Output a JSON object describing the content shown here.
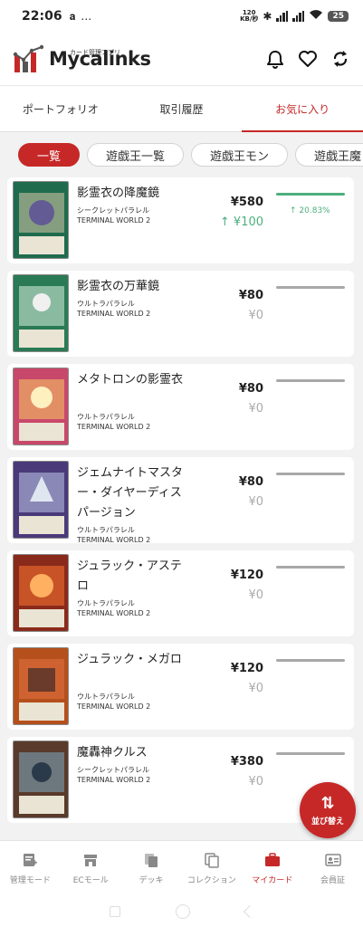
{
  "status_bar": {
    "time": "22:06",
    "left_icons": "…",
    "net_speed_top": "120",
    "net_speed_bottom": "KB/秒",
    "battery": "25"
  },
  "header": {
    "logo_sub": "カード管理アプリ",
    "logo_main": "Mycalinks",
    "icons": [
      "bell-icon",
      "heart-icon",
      "sync-icon"
    ]
  },
  "tabs": [
    {
      "label": "ポートフォリオ",
      "active": false
    },
    {
      "label": "取引履歴",
      "active": false
    },
    {
      "label": "お気に入り",
      "active": true
    }
  ],
  "chips": [
    {
      "label": "一覧",
      "active": true
    },
    {
      "label": "遊戯王一覧",
      "active": false
    },
    {
      "label": "遊戯王モン",
      "active": false
    },
    {
      "label": "遊戯王魔",
      "active": false
    }
  ],
  "cards": [
    {
      "name": "影霊衣の降魔鏡",
      "rarity": "シークレットパラレル",
      "set": "TERMINAL WORLD 2",
      "price": "¥580",
      "diff": "↑ ¥100",
      "diff_up": true,
      "pct": "↑ 20.83%"
    },
    {
      "name": "影霊衣の万華鏡",
      "rarity": "ウルトラパラレル",
      "set": "TERMINAL WORLD 2",
      "price": "¥80",
      "diff": "¥0",
      "diff_up": false,
      "pct": ""
    },
    {
      "name": "メタトロンの影霊衣",
      "rarity": "ウルトラパラレル",
      "set": "TERMINAL WORLD 2",
      "price": "¥80",
      "diff": "¥0",
      "diff_up": false,
      "pct": ""
    },
    {
      "name": "ジェムナイトマスター・ダイヤーディスパージョン",
      "rarity": "ウルトラパラレル",
      "set": "TERMINAL WORLD 2",
      "price": "¥80",
      "diff": "¥0",
      "diff_up": false,
      "pct": ""
    },
    {
      "name": "ジュラック・アステロ",
      "rarity": "ウルトラパラレル",
      "set": "TERMINAL WORLD 2",
      "price": "¥120",
      "diff": "¥0",
      "diff_up": false,
      "pct": ""
    },
    {
      "name": "ジュラック・メガロ",
      "rarity": "ウルトラパラレル",
      "set": "TERMINAL WORLD 2",
      "price": "¥120",
      "diff": "¥0",
      "diff_up": false,
      "pct": ""
    },
    {
      "name": "魔轟神クルス",
      "rarity": "シークレットパラレル",
      "set": "TERMINAL WORLD 2",
      "price": "¥380",
      "diff": "¥0",
      "diff_up": false,
      "pct": ""
    }
  ],
  "fab": {
    "arrows": "⇅",
    "label": "並び替え"
  },
  "bottom_nav": [
    {
      "label": "管理モード",
      "icon": "management-icon",
      "active": false
    },
    {
      "label": "ECモール",
      "icon": "store-icon",
      "active": false
    },
    {
      "label": "デッキ",
      "icon": "deck-icon",
      "active": false
    },
    {
      "label": "コレクション",
      "icon": "collection-icon",
      "active": false
    },
    {
      "label": "マイカード",
      "icon": "briefcase-icon",
      "active": true
    },
    {
      "label": "会員証",
      "icon": "member-card-icon",
      "active": false
    }
  ],
  "colors": {
    "accent": "#c62828",
    "up": "#4caf7d",
    "flat": "#aaaaaa"
  },
  "thumbnail_colors": [
    "#1f6b4e",
    "#2a7a55",
    "#c8486b",
    "#4a3a7a",
    "#8a2a1a",
    "#b5501c",
    "#5a3a2a"
  ]
}
